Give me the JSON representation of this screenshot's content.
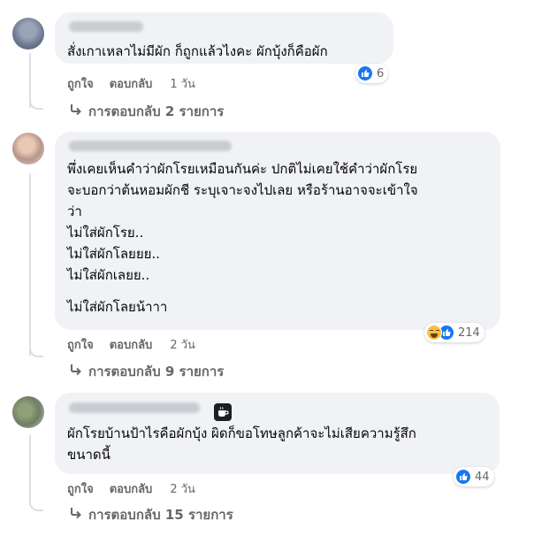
{
  "comments": [
    {
      "text_lines": [
        "สั่งเกาเหลาไม่มีผัก ก็ถูกแล้วไงคะ ผักบุ้งก็คือผัก"
      ],
      "reaction_count": "6",
      "actions": {
        "like": "ถูกใจ",
        "reply": "ตอบกลับ",
        "time": "1 วัน"
      },
      "replies_label": "การตอบกลับ 2 รายการ"
    },
    {
      "text_lines": [
        "พึ่งเคยเห็นคำว่าผักโรยเหมือนกันค่ะ ปกติไม่เคยใช้คำว่าผักโรย",
        "จะบอกว่าต้นหอมผักชี ระบุเจาะจงไปเลย หรือร้านอาจจะเข้าใจ",
        "ว่า",
        "ไม่ใส่ผักโรย..",
        "ไม่ใส่ผักโลยยย..",
        "ไม่ใส่ผักเลยย..",
        "ไม่ใส่ผักโลยน้าาา"
      ],
      "reaction_count": "214",
      "actions": {
        "like": "ถูกใจ",
        "reply": "ตอบกลับ",
        "time": "2 วัน"
      },
      "replies_label": "การตอบกลับ 9 รายการ"
    },
    {
      "text_lines": [
        "ผักโรยบ้านป้าไรคือผักบุ้ง ผิดก็ขอโทษลูกค้าจะไม่เสียความรู้สึก",
        "ขนาดนี้"
      ],
      "reaction_count": "44",
      "actions": {
        "like": "ถูกใจ",
        "reply": "ตอบกลับ",
        "time": "2 วัน"
      },
      "replies_label": "การตอบกลับ 15 รายการ"
    }
  ],
  "icons": {
    "like": "like-icon",
    "haha": "haha-icon",
    "reply_arrow": "reply-arrow-icon",
    "coffee": "coffee-icon"
  },
  "colors": {
    "bubble": "#f0f2f5",
    "secondary_text": "#65676b",
    "like_blue": "#1877f2"
  }
}
